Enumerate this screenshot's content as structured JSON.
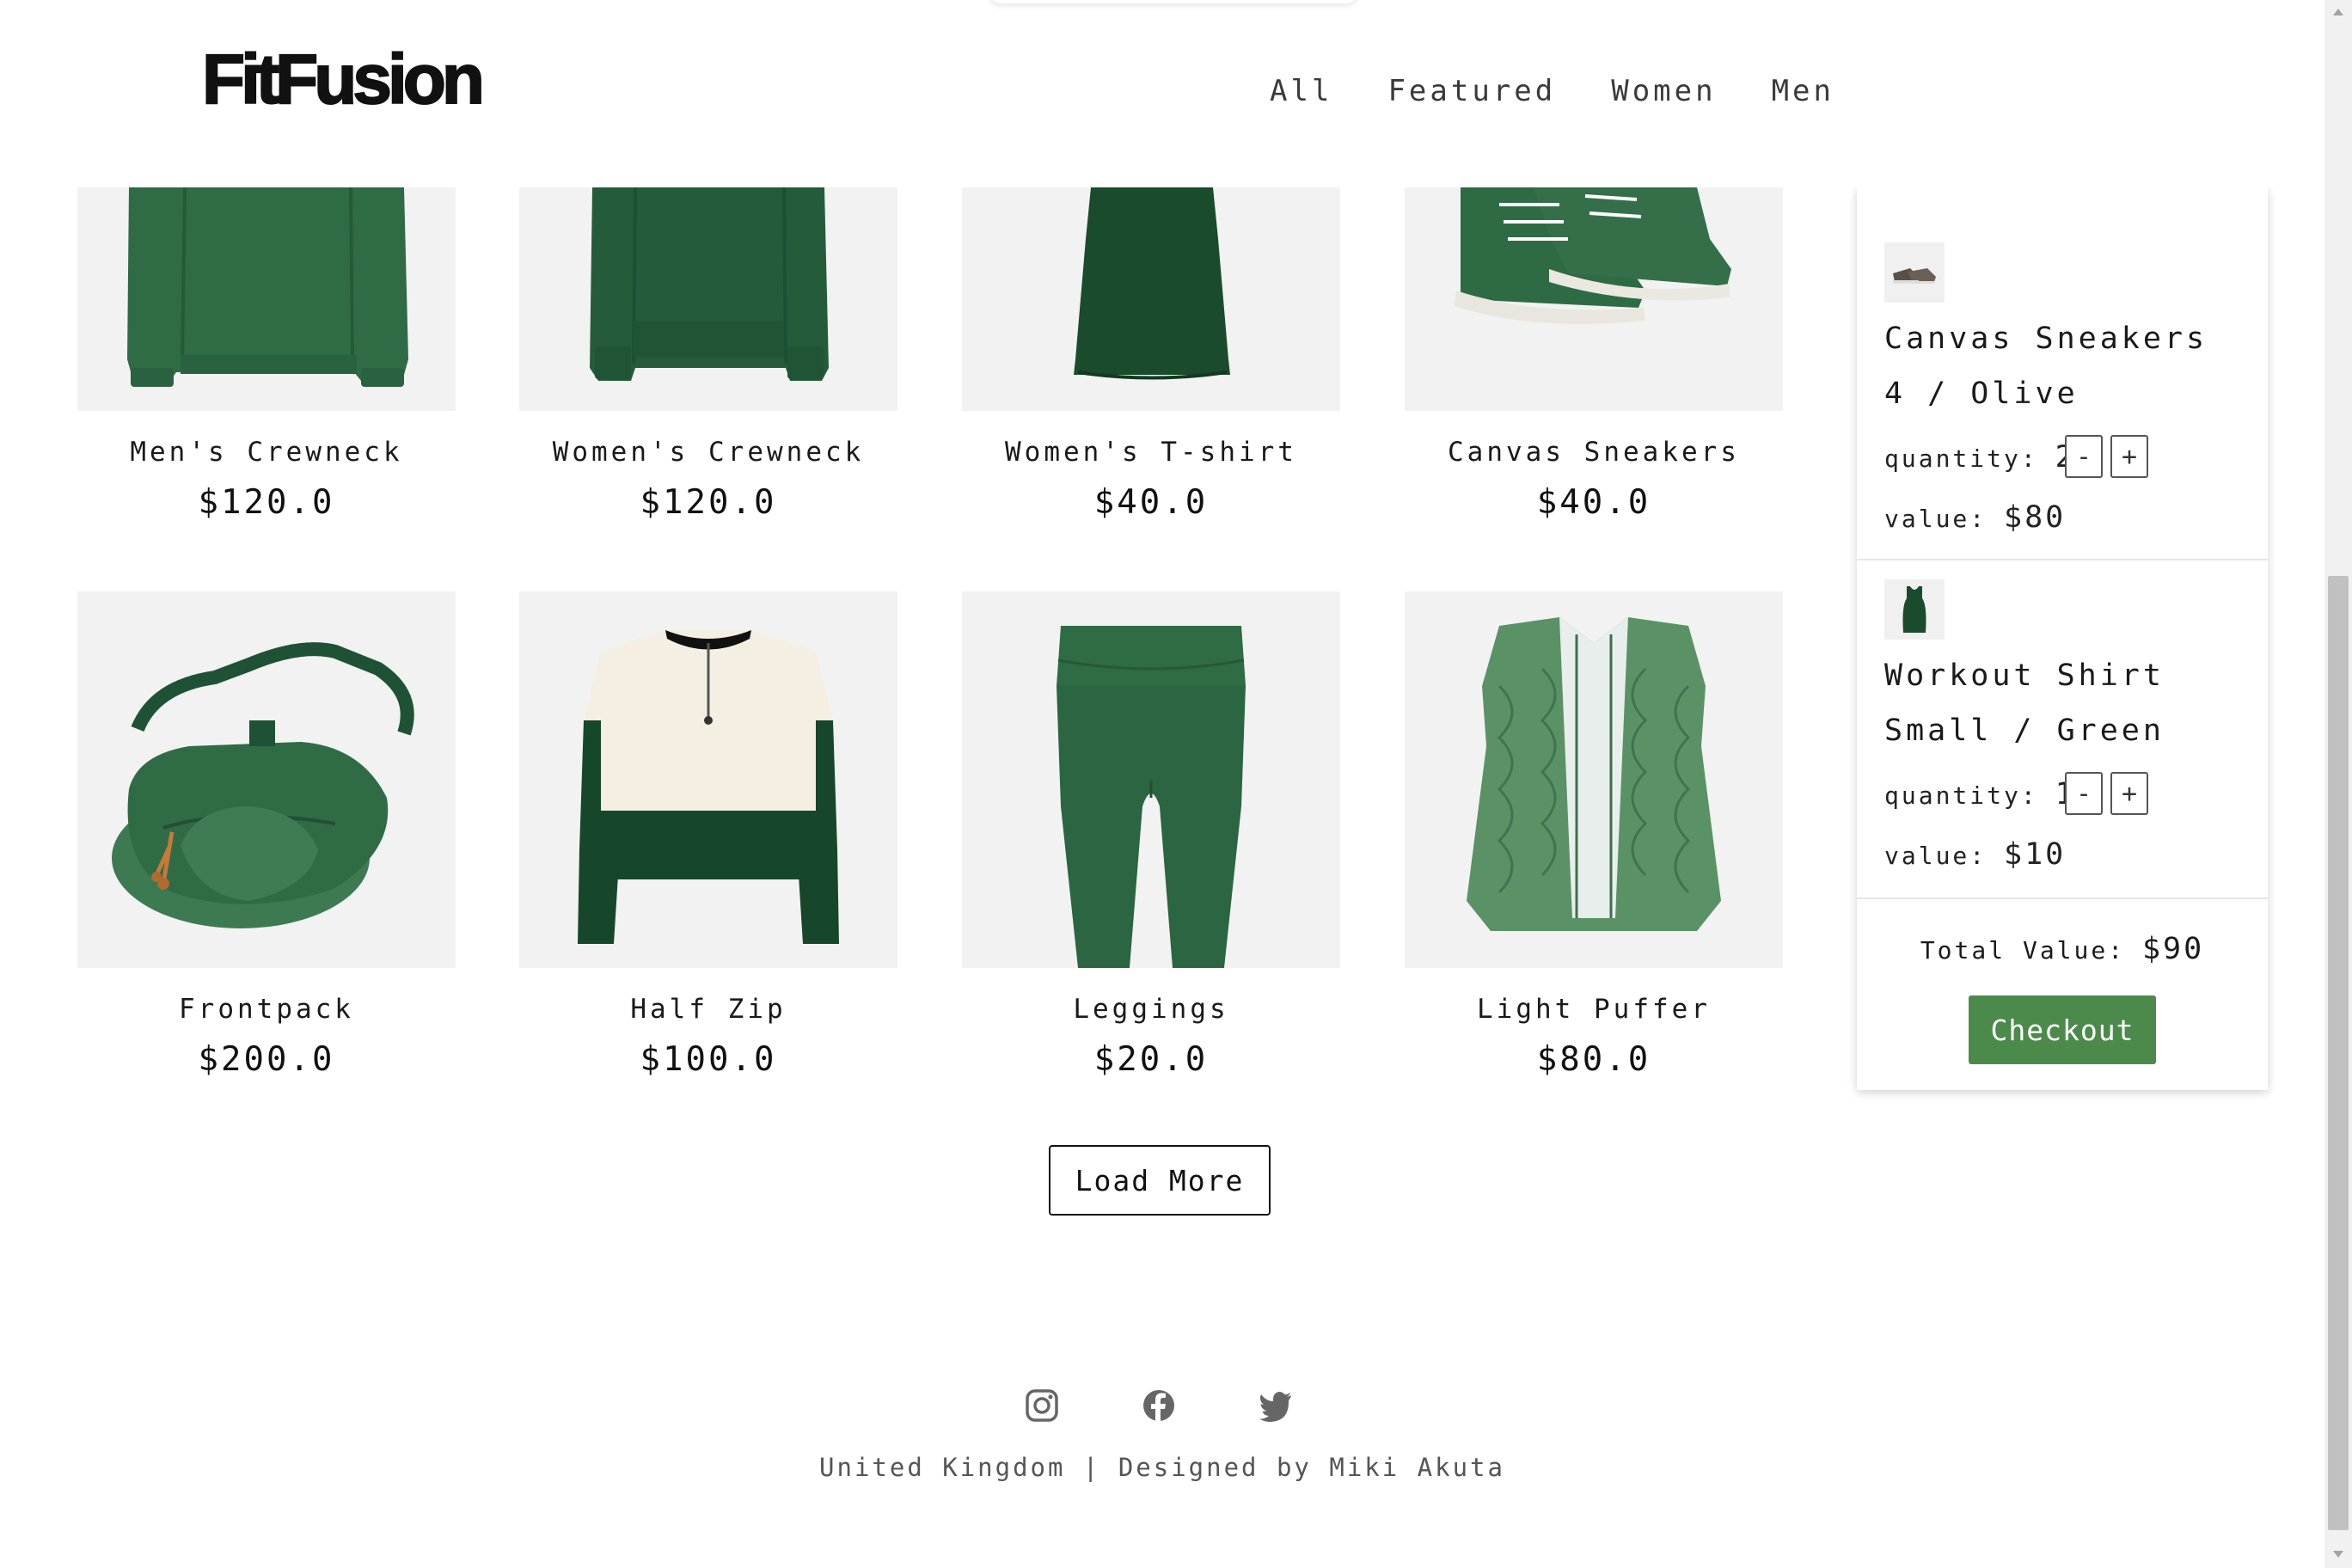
{
  "header": {
    "logo": "FitFusion",
    "nav": [
      "All",
      "Featured",
      "Women",
      "Men"
    ]
  },
  "products": [
    {
      "name": "Men's Crewneck",
      "price": "$120.0"
    },
    {
      "name": "Women's Crewneck",
      "price": "$120.0"
    },
    {
      "name": "Women's T-shirt",
      "price": "$40.0"
    },
    {
      "name": "Canvas Sneakers",
      "price": "$40.0"
    },
    {
      "name": "Frontpack",
      "price": "$200.0"
    },
    {
      "name": "Half Zip",
      "price": "$100.0"
    },
    {
      "name": "Leggings",
      "price": "$20.0"
    },
    {
      "name": "Light Puffer",
      "price": "$80.0"
    }
  ],
  "load_more": "Load More",
  "cart": {
    "items": [
      {
        "name": "Canvas Sneakers",
        "variant": "4 / Olive",
        "quantity_label": "quantity:",
        "quantity": "2",
        "value_label": "value:",
        "value": "$80"
      },
      {
        "name": "Workout Shirt",
        "variant": "Small / Green",
        "quantity_label": "quantity:",
        "quantity": "1",
        "value_label": "value:",
        "value": "$10"
      }
    ],
    "minus": "-",
    "plus": "+",
    "total_label": "Total Value:",
    "total": "$90",
    "checkout": "Checkout"
  },
  "footer": {
    "icons": [
      "instagram-icon",
      "facebook-icon",
      "twitter-icon"
    ],
    "text": "United Kingdom | Designed by Miki Akuta"
  },
  "colors": {
    "accent": "#4c8a4c",
    "product_green": "#2f6b45",
    "image_bg": "#f2f2f2"
  }
}
